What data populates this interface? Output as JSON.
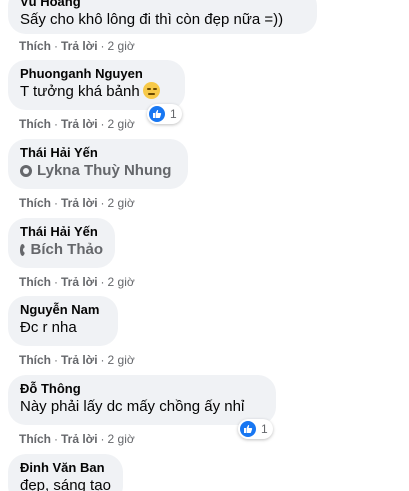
{
  "action_labels": {
    "like": "Thích",
    "reply": "Trả lời",
    "separator": "·"
  },
  "comments": [
    {
      "author": "Vũ Hoàng",
      "text": "Sấy cho khô lông đi thì còn đẹp nữa =))",
      "time": "2 giờ"
    },
    {
      "author": "Phuonganh Nguyen",
      "text": "T tưởng khá bảnh",
      "time": "2 giờ",
      "reaction_count": "1"
    },
    {
      "author": "Thái Hải Yến",
      "mention": "Lykna Thuỳ Nhung",
      "time": "2 giờ"
    },
    {
      "author": "Thái Hải Yến",
      "mention": "Bích Thảo",
      "time": "2 giờ"
    },
    {
      "author": "Nguyễn Nam",
      "text": "Đc r nha",
      "time": "2 giờ"
    },
    {
      "author": "Đỗ Thông",
      "text": "Này phải lấy dc mấy chồng ấy nhỉ",
      "time": "2 giờ",
      "reaction_count": "1"
    },
    {
      "author": "Đinh Văn Ban",
      "text": "đẹp, sáng tạo"
    }
  ],
  "colors": {
    "like_blue": "#1877f2",
    "bubble_bg": "#f0f2f5",
    "meta_gray": "#65676b"
  },
  "icons": {
    "reaction": "like-icon",
    "mention": "tag-icon",
    "emoji": "smirk-emoji-icon"
  }
}
